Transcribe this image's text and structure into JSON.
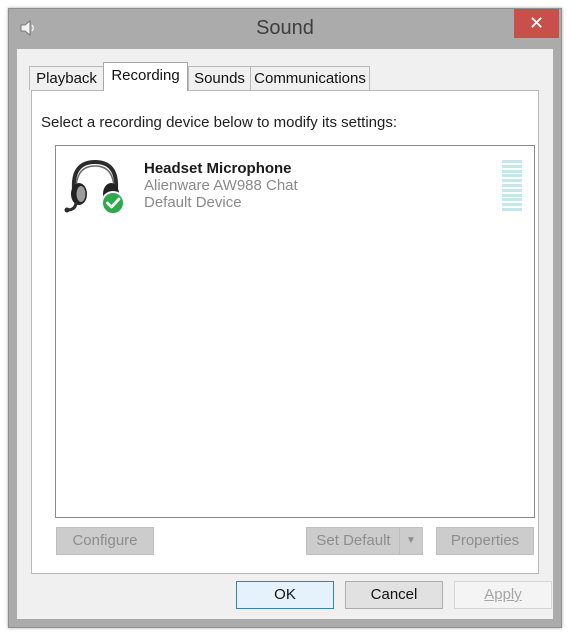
{
  "window": {
    "title": "Sound",
    "close_glyph": "✕",
    "app_icon": "speaker-icon"
  },
  "tabs": [
    {
      "label": "Playback",
      "active": false
    },
    {
      "label": "Recording",
      "active": true
    },
    {
      "label": "Sounds",
      "active": false
    },
    {
      "label": "Communications",
      "active": false
    }
  ],
  "recording": {
    "instruction": "Select a recording device below to modify its settings:",
    "devices": [
      {
        "name": "Headset Microphone",
        "description": "Alienware AW988 Chat",
        "status": "Default Device",
        "icon": "headset-icon",
        "badge": "default-check-icon"
      }
    ],
    "level_meter_level": 0
  },
  "buttons": {
    "configure": "Configure",
    "set_default": "Set Default",
    "set_default_arrow": "▼",
    "properties": "Properties",
    "ok": "OK",
    "cancel": "Cancel",
    "apply": "Apply"
  },
  "colors": {
    "close_button": "#c7504a",
    "check_badge": "#2ea94d",
    "level_meter": "#c5e6ea",
    "ok_border": "#3c7fb1"
  }
}
